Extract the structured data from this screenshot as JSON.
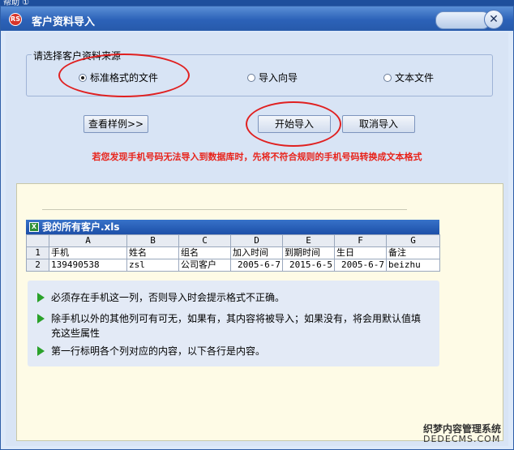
{
  "top_strip": "帮助 ①",
  "window": {
    "title": "客户资料导入",
    "icon_text": "RS"
  },
  "source_group": {
    "legend": "请选择客户资料来源",
    "options": [
      {
        "label": "标准格式的文件",
        "selected": true
      },
      {
        "label": "导入向导",
        "selected": false
      },
      {
        "label": "文本文件",
        "selected": false
      }
    ]
  },
  "buttons": {
    "view_sample": "查看样例>>",
    "start_import": "开始导入",
    "cancel_import": "取消导入"
  },
  "warning": "若您发现手机号码无法导入到数据库时，先将不符合规则的手机号码转换成文本格式",
  "sample_sheet": {
    "title": "我的所有客户.xls",
    "columns": [
      "A",
      "B",
      "C",
      "D",
      "E",
      "F",
      "G"
    ],
    "rows": [
      {
        "num": "1",
        "cells": [
          "手机",
          "姓名",
          "组名",
          "加入时间",
          "到期时间",
          "生日",
          "备注"
        ]
      },
      {
        "num": "2",
        "cells": [
          "139490538",
          "zsl",
          "公司客户",
          "2005-6-7",
          "2015-6-5",
          "2005-6-7",
          "beizhu"
        ]
      }
    ]
  },
  "notes": [
    "必须存在手机这一列，否则导入时会提示格式不正确。",
    "除手机以外的其他列可有可无，如果有，其内容将被导入；如果没有，将会用默认值填充这些属性",
    "第一行标明各个列对应的内容，以下各行是内容。"
  ],
  "watermark": {
    "line1": "织梦内容管理系统",
    "line2": "DEDECMS.COM"
  },
  "colors": {
    "titlebar": "#2c62b8",
    "warning": "#e8231b",
    "highlight_oval": "#e02020",
    "sample_bg": "#fefbe6"
  }
}
